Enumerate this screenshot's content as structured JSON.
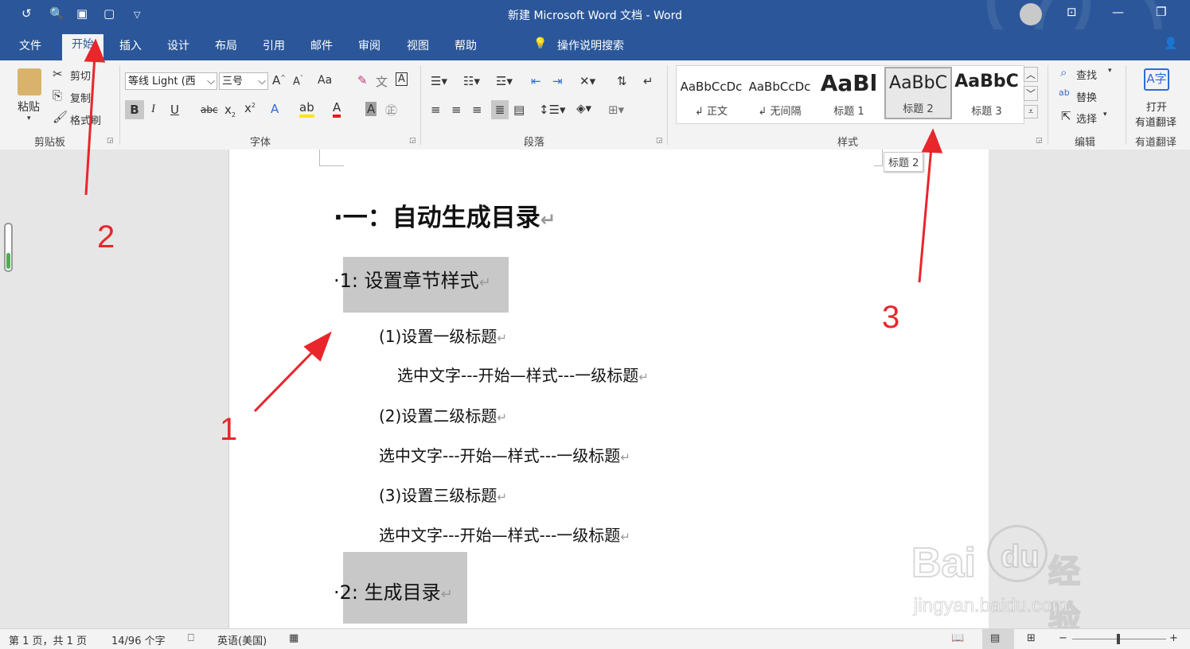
{
  "titlebar": {
    "title": "新建 Microsoft Word 文档  -  Word"
  },
  "tabs": [
    "文件",
    "开始",
    "插入",
    "设计",
    "布局",
    "引用",
    "邮件",
    "审阅",
    "视图",
    "帮助"
  ],
  "tell_me": "操作说明搜索",
  "clipboard": {
    "paste": "粘贴",
    "cut": "剪切",
    "copy": "复制",
    "format_painter": "格式刷",
    "group": "剪贴板"
  },
  "font": {
    "name": "等线 Light (西",
    "size": "三号",
    "change_case": "Aa",
    "group": "字体"
  },
  "paragraph": {
    "group": "段落"
  },
  "styles": {
    "items": [
      {
        "preview": "AaBbCcDc",
        "name": "↲ 正文"
      },
      {
        "preview": "AaBbCcDc",
        "name": "↲ 无间隔"
      },
      {
        "preview": "AaBl",
        "name": "标题 1"
      },
      {
        "preview": "AaBbC",
        "name": "标题 2"
      },
      {
        "preview": "AaBbC",
        "name": "标题 3"
      }
    ],
    "group": "样式",
    "tooltip": "标题 2"
  },
  "editing": {
    "find": "查找",
    "replace": "替换",
    "select": "选择",
    "group": "编辑"
  },
  "translate": {
    "btn_line1": "打开",
    "btn_line2": "有道翻译",
    "group": "有道翻译"
  },
  "document": {
    "h1": "一：自动生成目录",
    "h2a": "1: 设置章节样式",
    "line1": "(1)设置一级标题",
    "line2": "选中文字---开始—样式---一级标题",
    "line3": "(2)设置二级标题",
    "line4": "选中文字---开始—样式---一级标题",
    "line5": "(3)设置三级标题",
    "line6": "选中文字---开始—样式---一级标题",
    "h2b": "2: 生成目录"
  },
  "annotations": [
    "1",
    "2",
    "3"
  ],
  "statusbar": {
    "page": "第 1 页，共 1 页",
    "words": "14/96 个字",
    "language": "英语(美国)"
  },
  "watermark": {
    "brand": "Bai",
    "brand2": "du",
    "suffix": "经验",
    "url": "jingyan.baidu.com"
  },
  "colors": {
    "word_blue": "#2b579a",
    "annotation_red": "#e8262b"
  }
}
